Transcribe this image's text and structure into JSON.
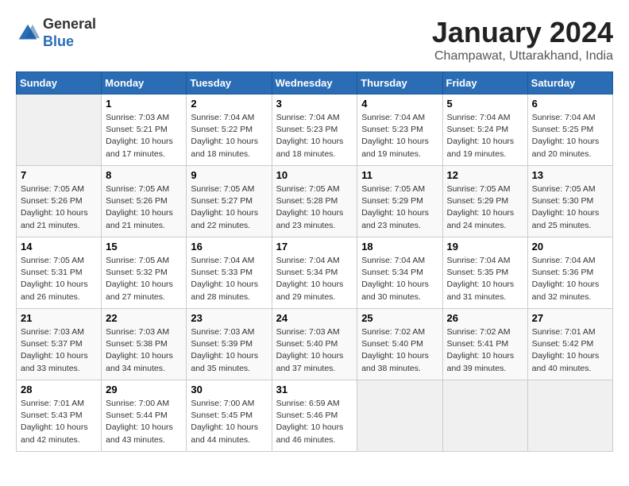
{
  "header": {
    "logo_line1": "General",
    "logo_line2": "Blue",
    "title": "January 2024",
    "subtitle": "Champawat, Uttarakhand, India"
  },
  "days_of_week": [
    "Sunday",
    "Monday",
    "Tuesday",
    "Wednesday",
    "Thursday",
    "Friday",
    "Saturday"
  ],
  "weeks": [
    [
      {
        "num": "",
        "info": ""
      },
      {
        "num": "1",
        "info": "Sunrise: 7:03 AM\nSunset: 5:21 PM\nDaylight: 10 hours\nand 17 minutes."
      },
      {
        "num": "2",
        "info": "Sunrise: 7:04 AM\nSunset: 5:22 PM\nDaylight: 10 hours\nand 18 minutes."
      },
      {
        "num": "3",
        "info": "Sunrise: 7:04 AM\nSunset: 5:23 PM\nDaylight: 10 hours\nand 18 minutes."
      },
      {
        "num": "4",
        "info": "Sunrise: 7:04 AM\nSunset: 5:23 PM\nDaylight: 10 hours\nand 19 minutes."
      },
      {
        "num": "5",
        "info": "Sunrise: 7:04 AM\nSunset: 5:24 PM\nDaylight: 10 hours\nand 19 minutes."
      },
      {
        "num": "6",
        "info": "Sunrise: 7:04 AM\nSunset: 5:25 PM\nDaylight: 10 hours\nand 20 minutes."
      }
    ],
    [
      {
        "num": "7",
        "info": "Sunrise: 7:05 AM\nSunset: 5:26 PM\nDaylight: 10 hours\nand 21 minutes."
      },
      {
        "num": "8",
        "info": "Sunrise: 7:05 AM\nSunset: 5:26 PM\nDaylight: 10 hours\nand 21 minutes."
      },
      {
        "num": "9",
        "info": "Sunrise: 7:05 AM\nSunset: 5:27 PM\nDaylight: 10 hours\nand 22 minutes."
      },
      {
        "num": "10",
        "info": "Sunrise: 7:05 AM\nSunset: 5:28 PM\nDaylight: 10 hours\nand 23 minutes."
      },
      {
        "num": "11",
        "info": "Sunrise: 7:05 AM\nSunset: 5:29 PM\nDaylight: 10 hours\nand 23 minutes."
      },
      {
        "num": "12",
        "info": "Sunrise: 7:05 AM\nSunset: 5:29 PM\nDaylight: 10 hours\nand 24 minutes."
      },
      {
        "num": "13",
        "info": "Sunrise: 7:05 AM\nSunset: 5:30 PM\nDaylight: 10 hours\nand 25 minutes."
      }
    ],
    [
      {
        "num": "14",
        "info": "Sunrise: 7:05 AM\nSunset: 5:31 PM\nDaylight: 10 hours\nand 26 minutes."
      },
      {
        "num": "15",
        "info": "Sunrise: 7:05 AM\nSunset: 5:32 PM\nDaylight: 10 hours\nand 27 minutes."
      },
      {
        "num": "16",
        "info": "Sunrise: 7:04 AM\nSunset: 5:33 PM\nDaylight: 10 hours\nand 28 minutes."
      },
      {
        "num": "17",
        "info": "Sunrise: 7:04 AM\nSunset: 5:34 PM\nDaylight: 10 hours\nand 29 minutes."
      },
      {
        "num": "18",
        "info": "Sunrise: 7:04 AM\nSunset: 5:34 PM\nDaylight: 10 hours\nand 30 minutes."
      },
      {
        "num": "19",
        "info": "Sunrise: 7:04 AM\nSunset: 5:35 PM\nDaylight: 10 hours\nand 31 minutes."
      },
      {
        "num": "20",
        "info": "Sunrise: 7:04 AM\nSunset: 5:36 PM\nDaylight: 10 hours\nand 32 minutes."
      }
    ],
    [
      {
        "num": "21",
        "info": "Sunrise: 7:03 AM\nSunset: 5:37 PM\nDaylight: 10 hours\nand 33 minutes."
      },
      {
        "num": "22",
        "info": "Sunrise: 7:03 AM\nSunset: 5:38 PM\nDaylight: 10 hours\nand 34 minutes."
      },
      {
        "num": "23",
        "info": "Sunrise: 7:03 AM\nSunset: 5:39 PM\nDaylight: 10 hours\nand 35 minutes."
      },
      {
        "num": "24",
        "info": "Sunrise: 7:03 AM\nSunset: 5:40 PM\nDaylight: 10 hours\nand 37 minutes."
      },
      {
        "num": "25",
        "info": "Sunrise: 7:02 AM\nSunset: 5:40 PM\nDaylight: 10 hours\nand 38 minutes."
      },
      {
        "num": "26",
        "info": "Sunrise: 7:02 AM\nSunset: 5:41 PM\nDaylight: 10 hours\nand 39 minutes."
      },
      {
        "num": "27",
        "info": "Sunrise: 7:01 AM\nSunset: 5:42 PM\nDaylight: 10 hours\nand 40 minutes."
      }
    ],
    [
      {
        "num": "28",
        "info": "Sunrise: 7:01 AM\nSunset: 5:43 PM\nDaylight: 10 hours\nand 42 minutes."
      },
      {
        "num": "29",
        "info": "Sunrise: 7:00 AM\nSunset: 5:44 PM\nDaylight: 10 hours\nand 43 minutes."
      },
      {
        "num": "30",
        "info": "Sunrise: 7:00 AM\nSunset: 5:45 PM\nDaylight: 10 hours\nand 44 minutes."
      },
      {
        "num": "31",
        "info": "Sunrise: 6:59 AM\nSunset: 5:46 PM\nDaylight: 10 hours\nand 46 minutes."
      },
      {
        "num": "",
        "info": ""
      },
      {
        "num": "",
        "info": ""
      },
      {
        "num": "",
        "info": ""
      }
    ]
  ]
}
